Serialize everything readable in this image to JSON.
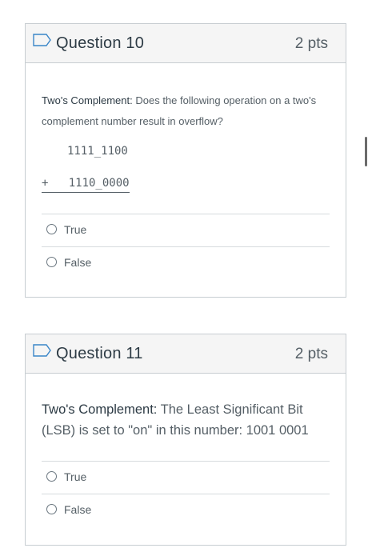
{
  "questions": [
    {
      "title": "Question 10",
      "points": "2 pts",
      "topic": "Two's Complement:",
      "prompt": " Does the following operation on a two's complement number result in overflow?",
      "operand_1": "1111_1100",
      "operand_2": "+   1110_0000",
      "answers": [
        "True",
        "False"
      ]
    },
    {
      "title": "Question 11",
      "points": "2 pts",
      "topic": "Two's Complement:",
      "prompt": " The Least Significant Bit (LSB) is set to \"on\" in this number: 1001 0001",
      "answers": [
        "True",
        "False"
      ]
    }
  ],
  "icons": {
    "flag": "flag-outline-icon",
    "radio": "radio-unselected-icon"
  },
  "colors": {
    "header_bg": "#f5f5f5",
    "border": "#c7cdd1",
    "text": "#2d3b45",
    "muted_text": "#555f66",
    "flag": "#3a86c8"
  }
}
